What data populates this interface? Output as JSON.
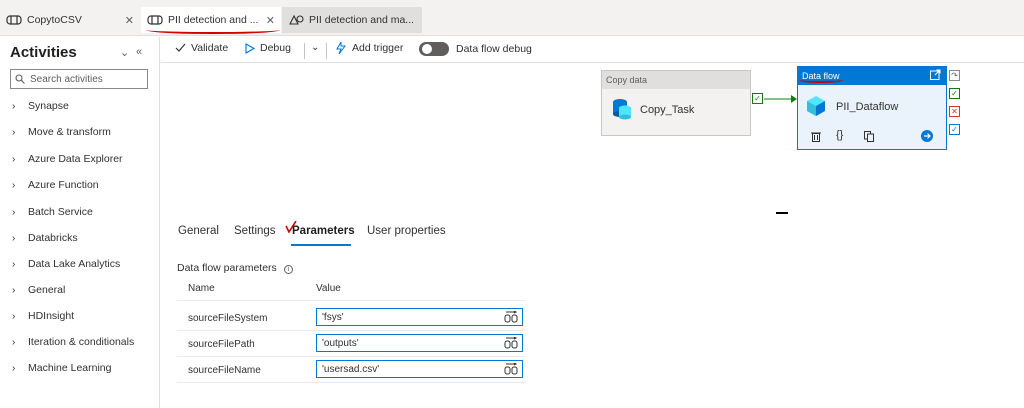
{
  "tabs": [
    {
      "label": "CopytoCSV",
      "icon": "pipeline-icon",
      "closable": true
    },
    {
      "label": "PII detection and ...",
      "icon": "pipeline-icon",
      "closable": true,
      "active": true
    },
    {
      "label": "PII detection and ma...",
      "icon": "dataflow-icon",
      "closable": false
    }
  ],
  "sidebar": {
    "title": "Activities",
    "search_placeholder": "Search activities",
    "items": [
      {
        "label": "Synapse"
      },
      {
        "label": "Move & transform"
      },
      {
        "label": "Azure Data Explorer"
      },
      {
        "label": "Azure Function"
      },
      {
        "label": "Batch Service"
      },
      {
        "label": "Databricks"
      },
      {
        "label": "Data Lake Analytics"
      },
      {
        "label": "General"
      },
      {
        "label": "HDInsight"
      },
      {
        "label": "Iteration & conditionals"
      },
      {
        "label": "Machine Learning"
      }
    ]
  },
  "toolbar": {
    "validate": "Validate",
    "debug": "Debug",
    "add_trigger": "Add trigger",
    "dataflow_debug": "Data flow debug"
  },
  "canvas": {
    "copy_node": {
      "header": "Copy data",
      "name": "Copy_Task"
    },
    "dataflow_node": {
      "header": "Data flow",
      "name": "PII_Dataflow"
    }
  },
  "details": {
    "tabs": [
      "General",
      "Settings",
      "Parameters",
      "User properties"
    ],
    "active_tab": "Parameters",
    "section_title": "Data flow parameters",
    "columns": {
      "name": "Name",
      "value": "Value"
    },
    "params": [
      {
        "name": "sourceFileSystem",
        "value": "'fsys'"
      },
      {
        "name": "sourceFilePath",
        "value": "'outputs'"
      },
      {
        "name": "sourceFileName",
        "value": "'usersad.csv'"
      }
    ]
  },
  "colors": {
    "accent": "#0078d4",
    "success": "#107c10",
    "error": "#d13438",
    "annotation": "#d40000"
  }
}
